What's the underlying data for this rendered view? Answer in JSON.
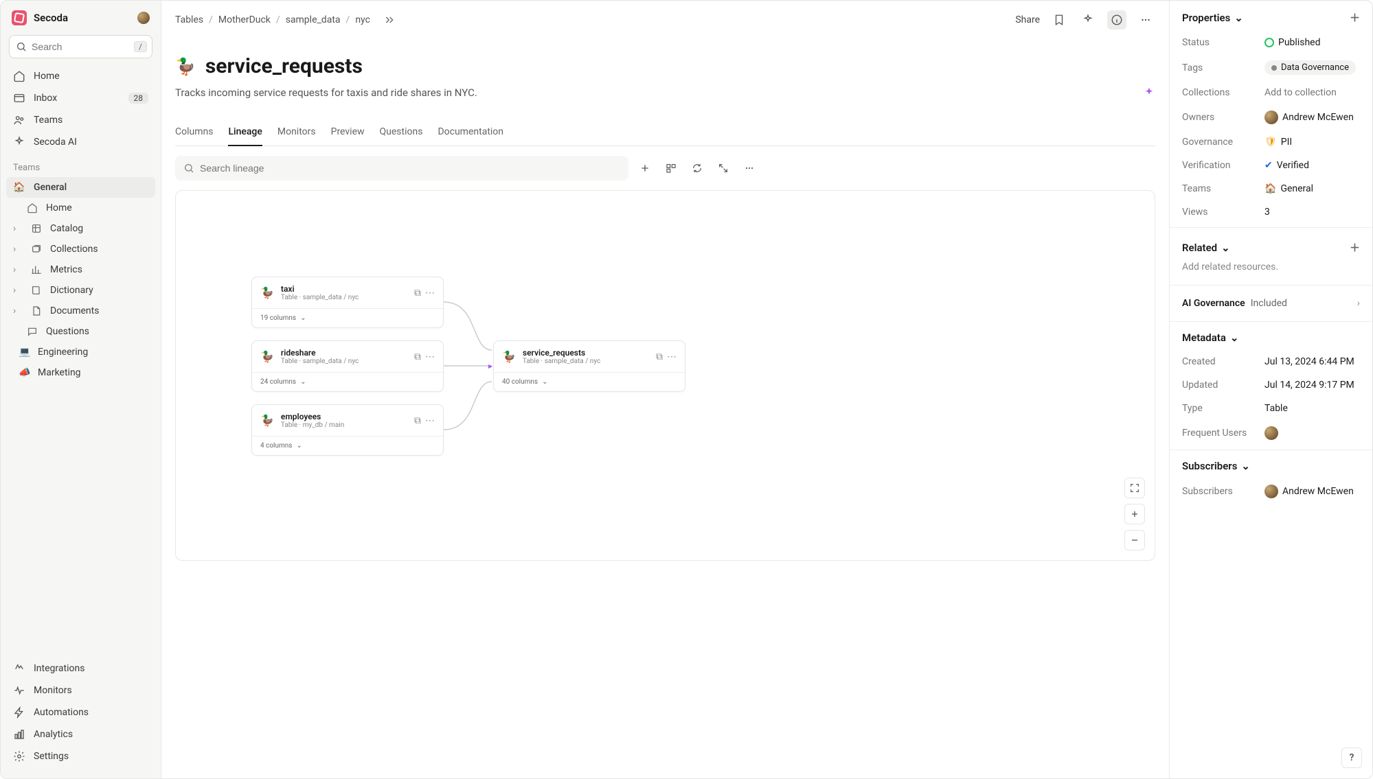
{
  "brand": "Secoda",
  "search": {
    "placeholder": "Search",
    "kbd": "/"
  },
  "nav": {
    "home": "Home",
    "inbox": "Inbox",
    "inbox_count": "28",
    "teams": "Teams",
    "ai": "Secoda AI"
  },
  "teams_label": "Teams",
  "teams": {
    "general": "General",
    "general_home": "Home",
    "catalog": "Catalog",
    "collections": "Collections",
    "metrics": "Metrics",
    "dictionary": "Dictionary",
    "documents": "Documents",
    "questions": "Questions",
    "engineering": "Engineering",
    "marketing": "Marketing"
  },
  "bottom_nav": {
    "integrations": "Integrations",
    "monitors": "Monitors",
    "automations": "Automations",
    "analytics": "Analytics",
    "settings": "Settings"
  },
  "breadcrumbs": [
    "Tables",
    "MotherDuck",
    "sample_data",
    "nyc"
  ],
  "share": "Share",
  "page": {
    "title": "service_requests",
    "subtitle": "Tracks incoming service requests for taxis and ride shares in NYC."
  },
  "tabs": [
    "Columns",
    "Lineage",
    "Monitors",
    "Preview",
    "Questions",
    "Documentation"
  ],
  "active_tab": 1,
  "lineage_search_placeholder": "Search lineage",
  "nodes": {
    "taxi": {
      "title": "taxi",
      "sub": "Table · sample_data / nyc",
      "cols": "19 columns"
    },
    "rideshare": {
      "title": "rideshare",
      "sub": "Table · sample_data / nyc",
      "cols": "24 columns"
    },
    "employees": {
      "title": "employees",
      "sub": "Table · my_db / main",
      "cols": "4 columns"
    },
    "service": {
      "title": "service_requests",
      "sub": "Table · sample_data / nyc",
      "cols": "40 columns"
    }
  },
  "props": {
    "header": "Properties",
    "status_label": "Status",
    "status": "Published",
    "tags_label": "Tags",
    "tag": "Data Governance",
    "collections_label": "Collections",
    "collections_empty": "Add to collection",
    "owners_label": "Owners",
    "owner": "Andrew McEwen",
    "governance_label": "Governance",
    "governance": "PII",
    "verification_label": "Verification",
    "verification": "Verified",
    "teams_label": "Teams",
    "team": "General",
    "views_label": "Views",
    "views": "3"
  },
  "related": {
    "header": "Related",
    "empty": "Add related resources."
  },
  "ai_gov": {
    "label": "AI Governance",
    "value": "Included"
  },
  "metadata": {
    "header": "Metadata",
    "created_label": "Created",
    "created": "Jul 13, 2024 6:44 PM",
    "updated_label": "Updated",
    "updated": "Jul 14, 2024 9:17 PM",
    "type_label": "Type",
    "type": "Table",
    "freq_label": "Frequent Users"
  },
  "subscribers": {
    "header": "Subscribers",
    "label": "Subscribers",
    "name": "Andrew McEwen"
  },
  "help": "?"
}
